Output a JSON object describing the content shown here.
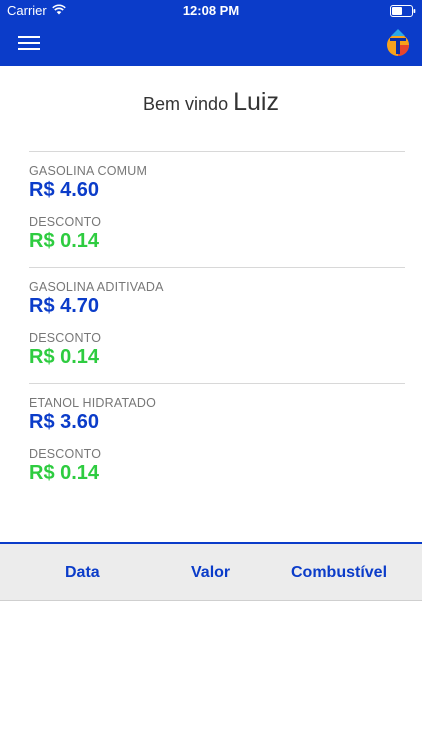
{
  "status_bar": {
    "carrier": "Carrier",
    "time": "12:08 PM"
  },
  "header": {
    "menu_icon": "hamburger-menu-icon",
    "logo_icon": "app-logo-icon",
    "colors": {
      "primary": "#0b3cc9"
    }
  },
  "welcome": {
    "greeting": "Bem vindo",
    "name": "Luiz"
  },
  "fuels": [
    {
      "name": "GASOLINA COMUM",
      "price": "R$ 4.60",
      "discount_label": "DESCONTO",
      "discount": "R$ 0.14"
    },
    {
      "name": "GASOLINA ADITIVADA",
      "price": "R$ 4.70",
      "discount_label": "DESCONTO",
      "discount": "R$ 0.14"
    },
    {
      "name": "ETANOL HIDRATADO",
      "price": "R$ 3.60",
      "discount_label": "DESCONTO",
      "discount": "R$ 0.14"
    }
  ],
  "table_header": {
    "col_date": "Data",
    "col_value": "Valor",
    "col_fuel": "Combustível"
  },
  "colors": {
    "price": "#0b3cc9",
    "discount": "#2ecc40"
  }
}
